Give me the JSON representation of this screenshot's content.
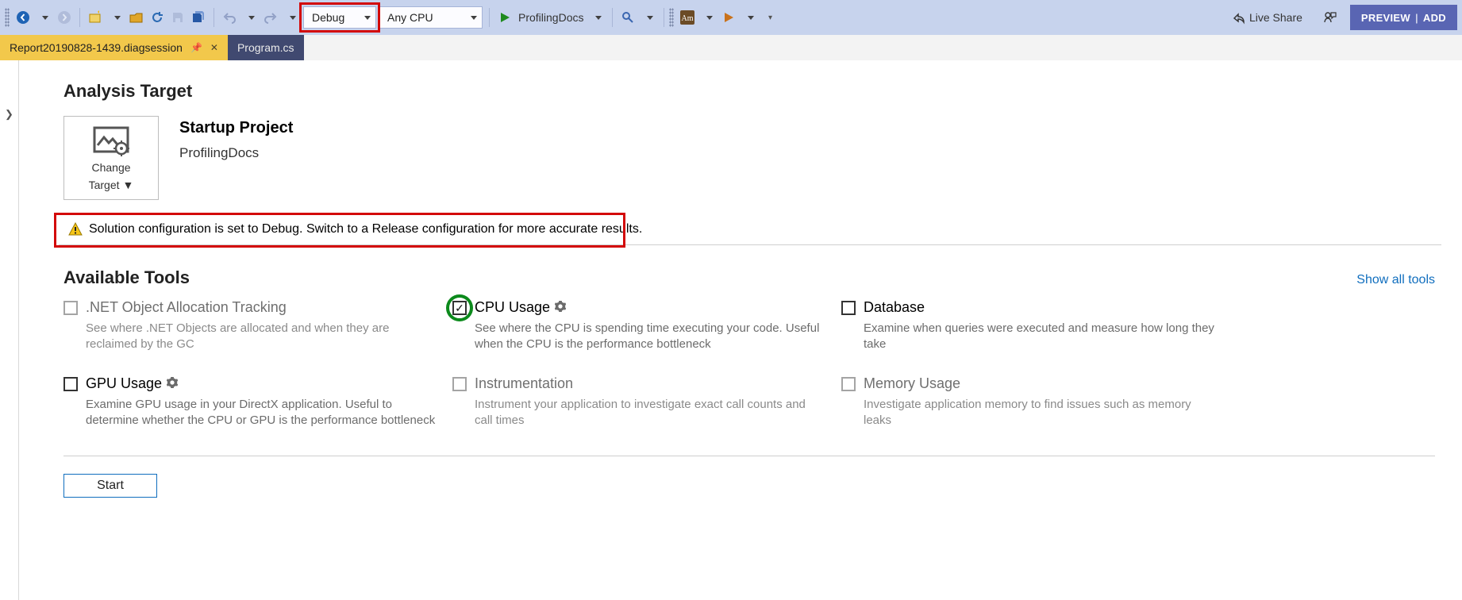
{
  "toolbar": {
    "config_label": "Debug",
    "platform_label": "Any CPU",
    "start_target_label": "ProfilingDocs",
    "live_share_label": "Live Share",
    "preview_label": "PREVIEW",
    "preview_secondary": "ADD"
  },
  "tabs": {
    "active_label": "Report20190828-1439.diagsession",
    "inactive_label": "Program.cs"
  },
  "analysis": {
    "heading": "Analysis Target",
    "change_target_line1": "Change",
    "change_target_line2": "Target",
    "startup_project_heading": "Startup Project",
    "startup_project_name": "ProfilingDocs",
    "warning_text": "Solution configuration is set to Debug. Switch to a Release configuration for more accurate results."
  },
  "tools_section": {
    "heading": "Available Tools",
    "show_all": "Show all tools"
  },
  "tools": [
    {
      "id": "net-alloc",
      "title": ".NET Object Allocation Tracking",
      "desc": "See where .NET Objects are allocated and when they are reclaimed by the GC",
      "checked": false,
      "enabled": false,
      "has_gear": false
    },
    {
      "id": "cpu-usage",
      "title": "CPU Usage",
      "desc": "See where the CPU is spending time executing your code. Useful when the CPU is the performance bottleneck",
      "checked": true,
      "enabled": true,
      "has_gear": true
    },
    {
      "id": "database",
      "title": "Database",
      "desc": "Examine when queries were executed and measure how long they take",
      "checked": false,
      "enabled": true,
      "has_gear": false
    },
    {
      "id": "gpu-usage",
      "title": "GPU Usage",
      "desc": "Examine GPU usage in your DirectX application. Useful to determine whether the CPU or GPU is the performance bottleneck",
      "checked": false,
      "enabled": true,
      "has_gear": true
    },
    {
      "id": "instrumentation",
      "title": "Instrumentation",
      "desc": "Instrument your application to investigate exact call counts and call times",
      "checked": false,
      "enabled": false,
      "has_gear": false
    },
    {
      "id": "memory-usage",
      "title": "Memory Usage",
      "desc": "Investigate application memory to find issues such as memory leaks",
      "checked": false,
      "enabled": false,
      "has_gear": false
    }
  ],
  "start_button": "Start"
}
